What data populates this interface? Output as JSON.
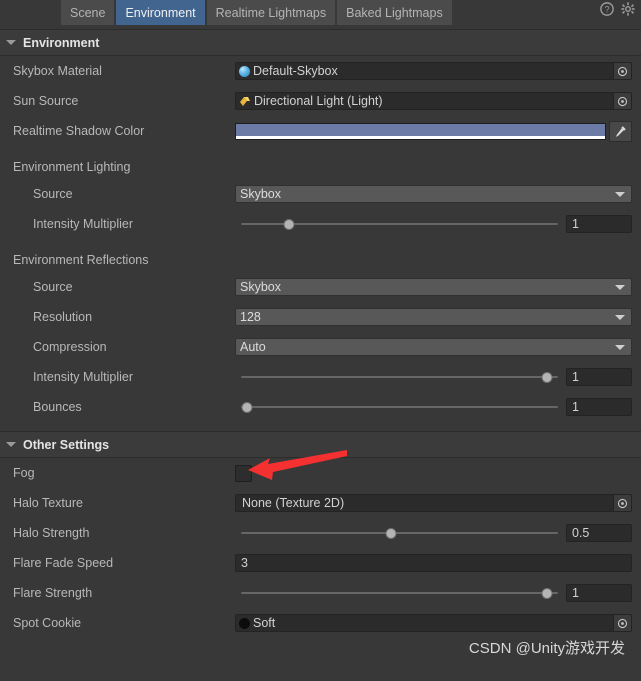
{
  "window": {
    "tabs": [
      {
        "label": "Scene",
        "active": false
      },
      {
        "label": "Environment",
        "active": true
      },
      {
        "label": "Realtime Lightmaps",
        "active": false
      },
      {
        "label": "Baked Lightmaps",
        "active": false
      }
    ],
    "help_icon": "help-icon",
    "settings_icon": "gear-icon"
  },
  "environment_section": {
    "header": "Environment",
    "skybox_material": {
      "label": "Skybox Material",
      "value": "Default-Skybox",
      "icon": "material-sphere-icon",
      "picker_icon": "object-picker-icon"
    },
    "sun_source": {
      "label": "Sun Source",
      "value": "Directional Light (Light)",
      "icon": "directional-light-icon",
      "picker_icon": "object-picker-icon"
    },
    "realtime_shadow_color": {
      "label": "Realtime Shadow Color",
      "color": "#6c7aa6",
      "alpha_color": "#ffffff",
      "eyedropper_icon": "eyedropper-icon"
    },
    "environment_lighting": {
      "label": "Environment Lighting",
      "source": {
        "label": "Source",
        "value": "Skybox"
      },
      "intensity_multiplier": {
        "label": "Intensity Multiplier",
        "value": "1",
        "slider_percent": 15
      }
    },
    "environment_reflections": {
      "label": "Environment Reflections",
      "source": {
        "label": "Source",
        "value": "Skybox"
      },
      "resolution": {
        "label": "Resolution",
        "value": "128"
      },
      "compression": {
        "label": "Compression",
        "value": "Auto"
      },
      "intensity_multiplier": {
        "label": "Intensity Multiplier",
        "value": "1",
        "slider_percent": 96
      },
      "bounces": {
        "label": "Bounces",
        "value": "1",
        "slider_percent": 2
      }
    }
  },
  "other_settings_section": {
    "header": "Other Settings",
    "fog": {
      "label": "Fog",
      "checked": false
    },
    "halo_texture": {
      "label": "Halo Texture",
      "value": "None (Texture 2D)",
      "picker_icon": "object-picker-icon"
    },
    "halo_strength": {
      "label": "Halo Strength",
      "value": "0.5",
      "slider_percent": 47
    },
    "flare_fade_speed": {
      "label": "Flare Fade Speed",
      "value": "3"
    },
    "flare_strength": {
      "label": "Flare Strength",
      "value": "1",
      "slider_percent": 96
    },
    "spot_cookie": {
      "label": "Spot Cookie",
      "value": "Soft",
      "icon": "texture-preview-icon",
      "picker_icon": "object-picker-icon"
    }
  },
  "annotation": {
    "arrow_color": "#f53030",
    "arrow_name": "red-pointer-arrow"
  },
  "watermark": {
    "text": "CSDN @Unity游戏开发"
  }
}
